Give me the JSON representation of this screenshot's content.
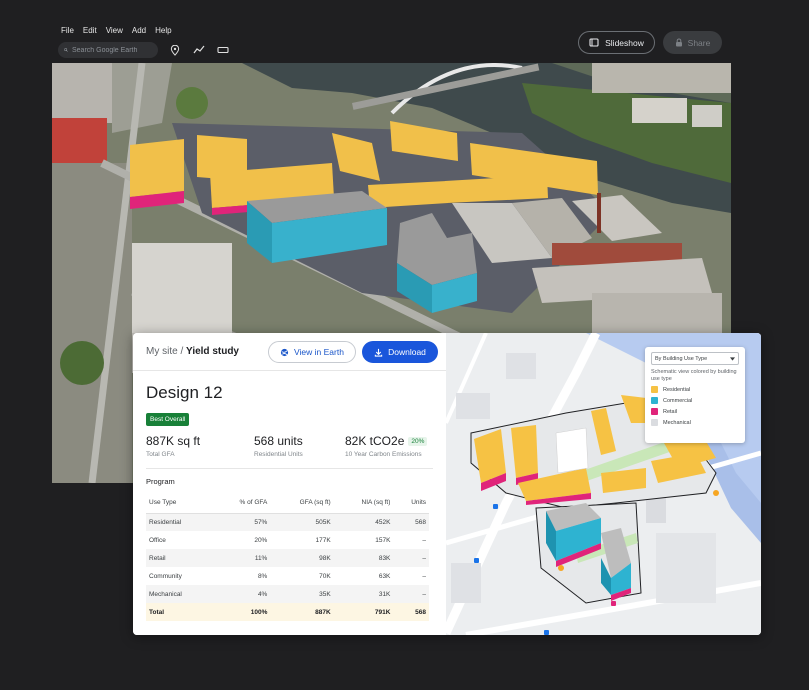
{
  "menu": [
    "File",
    "Edit",
    "View",
    "Add",
    "Help"
  ],
  "search": {
    "placeholder": "Search Google Earth"
  },
  "header": {
    "slideshow_label": "Slideshow",
    "share_label": "Share"
  },
  "panel": {
    "crumb_parent": "My site",
    "crumb_sep": " / ",
    "crumb_current": "Yield study",
    "view_earth_label": "View in Earth",
    "download_label": "Download",
    "design_title": "Design 12",
    "badge": "Best Overall",
    "stats": [
      {
        "value": "887K sq ft",
        "label": "Total GFA"
      },
      {
        "value": "568 units",
        "label": "Residential Units"
      },
      {
        "value": "82K tCO2e",
        "label": "10 Year Carbon Emissions",
        "chip": "20%"
      }
    ],
    "program_label": "Program",
    "table": {
      "headers": [
        "Use Type",
        "% of GFA",
        "GFA (sq ft)",
        "NIA (sq ft)",
        "Units"
      ],
      "rows": [
        [
          "Residential",
          "57%",
          "505K",
          "452K",
          "568"
        ],
        [
          "Office",
          "20%",
          "177K",
          "157K",
          "–"
        ],
        [
          "Retail",
          "11%",
          "98K",
          "83K",
          "–"
        ],
        [
          "Community",
          "8%",
          "70K",
          "63K",
          "–"
        ],
        [
          "Mechanical",
          "4%",
          "35K",
          "31K",
          "–"
        ]
      ],
      "total": [
        "Total",
        "100%",
        "887K",
        "791K",
        "568"
      ]
    }
  },
  "legend": {
    "select_value": "By Building Use Type",
    "description": "Schematic view colored by building use type",
    "items": [
      {
        "label": "Residential",
        "color": "#f6c244"
      },
      {
        "label": "Commercial",
        "color": "#2eb3d1"
      },
      {
        "label": "Retail",
        "color": "#e0247a"
      },
      {
        "label": "Mechanical",
        "color": "#dadce0"
      }
    ]
  },
  "icons": [
    "search-icon",
    "pin-icon",
    "path-icon",
    "ruler-icon",
    "slideshow-icon",
    "share-lock-icon",
    "earth-icon",
    "download-icon",
    "caret-down-icon"
  ]
}
